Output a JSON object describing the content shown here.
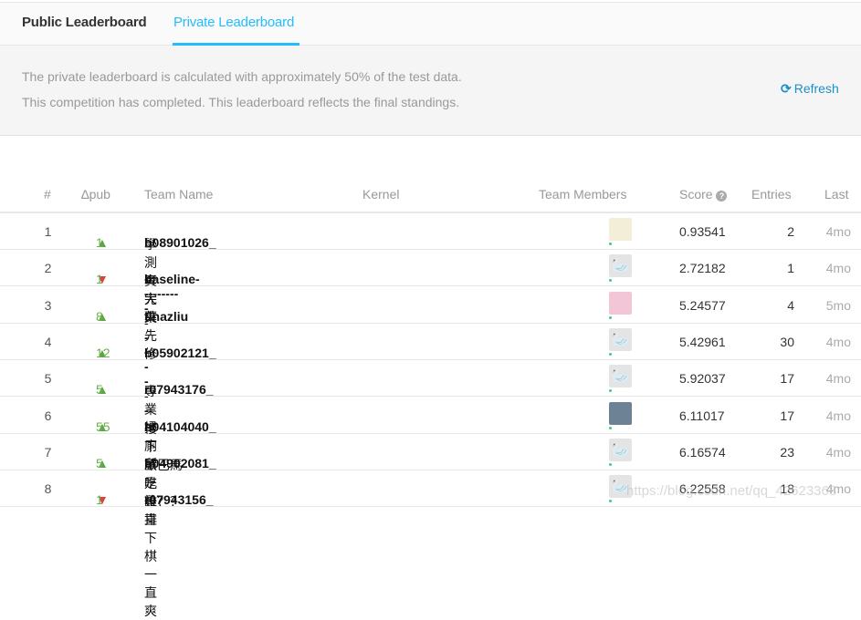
{
  "tabs": {
    "public": "Public Leaderboard",
    "private": "Private Leaderboard",
    "active": "private",
    "accent": "#20BEFF"
  },
  "info": {
    "line1": "The private leaderboard is calculated with approximately 50% of the test data.",
    "line2": "This competition has completed. This leaderboard reflects the final standings.",
    "refresh": "Refresh",
    "refresh_icon": "refresh-icon"
  },
  "columns": {
    "rank": "#",
    "delta": "∆pub",
    "team": "Team Name",
    "kernel": "Kernel",
    "members": "Team Members",
    "score": "Score",
    "entries": "Entries",
    "last": "Last"
  },
  "rows": [
    {
      "rank": "1",
      "dir": "up",
      "delta": "1",
      "team": "b08901026_",
      "team_cjk": "學測考完來先修",
      "avatar": "photo",
      "score": "0.93541",
      "entries": "2",
      "last": "4mo"
    },
    {
      "rank": "2",
      "dir": "down",
      "delta": "1",
      "team": "----------",
      "team_cjk": "真大葉",
      "team_tail": "baseline---------",
      "avatar": "goose",
      "score": "2.72182",
      "entries": "1",
      "last": "4mo"
    },
    {
      "rank": "3",
      "dir": "up",
      "delta": "8",
      "team": "tinazliu",
      "team_cjk": "",
      "avatar": "pink",
      "score": "5.24577",
      "entries": "4",
      "last": "5mo"
    },
    {
      "rank": "4",
      "dir": "up",
      "delta": "12",
      "team": "b05902121_",
      "team_cjk": "",
      "avatar": "goose",
      "score": "5.42961",
      "entries": "30",
      "last": "4mo"
    },
    {
      "rank": "5",
      "dir": "up",
      "delta": "5",
      "team": "r07943176_",
      "team_cjk": "專業掃廁所",
      "avatar": "goose",
      "score": "5.92037",
      "entries": "17",
      "last": "4mo"
    },
    {
      "rank": "6",
      "dir": "up",
      "delta": "55",
      "team": "b04104040_",
      "team_cjk": "樓下請吃雞排",
      "avatar": "photo2",
      "score": "6.11017",
      "entries": "17",
      "last": "4mo"
    },
    {
      "rank": "7",
      "dir": "up",
      "delta": "5",
      "team": "b04902081_",
      "team_cjk": "歐巴馬是誰？？",
      "avatar": "goose",
      "score": "6.16574",
      "entries": "23",
      "last": "4mo"
    },
    {
      "rank": "8",
      "dir": "down",
      "delta": "1",
      "team": "r07943156_",
      "team_cjk": "一直下棋一直爽",
      "avatar": "goose",
      "score": "6.22558",
      "entries": "18",
      "last": "4mo"
    }
  ],
  "watermark": "https://blog.csdn.net/qq_42623368"
}
